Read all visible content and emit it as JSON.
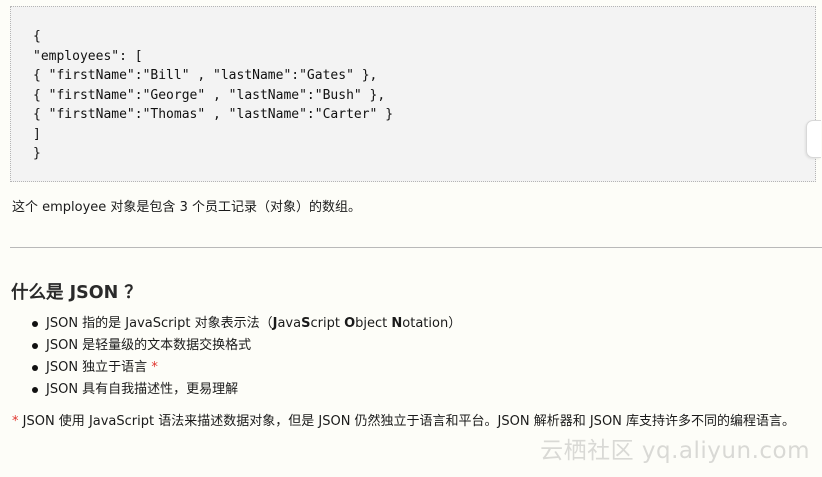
{
  "code_block": {
    "lines": [
      "{",
      "\"employees\": [",
      "{ \"firstName\":\"Bill\" , \"lastName\":\"Gates\" },",
      "{ \"firstName\":\"George\" , \"lastName\":\"Bush\" },",
      "{ \"firstName\":\"Thomas\" , \"lastName\":\"Carter\" }",
      "]",
      "}"
    ]
  },
  "description": "这个 employee 对象是包含 3 个员工记录（对象）的数组。",
  "section": {
    "heading": "什么是 JSON ？",
    "bullets": [
      {
        "before": "JSON 指的是 JavaScript 对象表示法（",
        "b1": "J",
        "t1": "ava",
        "b2": "S",
        "t2": "cript ",
        "b3": "O",
        "t3": "bject ",
        "b4": "N",
        "t4": "otation",
        "after": "）"
      },
      {
        "text": "JSON 是轻量级的文本数据交换格式"
      },
      {
        "text": "JSON 独立于语言",
        "star": "*"
      },
      {
        "text": "JSON 具有自我描述性，更易理解"
      }
    ]
  },
  "footnote": {
    "star": "*",
    "text": " JSON 使用 JavaScript 语法来描述数据对象，但是 JSON 仍然独立于语言和平台。JSON 解析器和 JSON 库支持许多不同的编程语言。"
  },
  "watermark": "云栖社区 yq.aliyun.com",
  "colors": {
    "accent_red": "#e0332c",
    "code_background": "#f3f3f3",
    "page_background": "#fdfdf8"
  }
}
